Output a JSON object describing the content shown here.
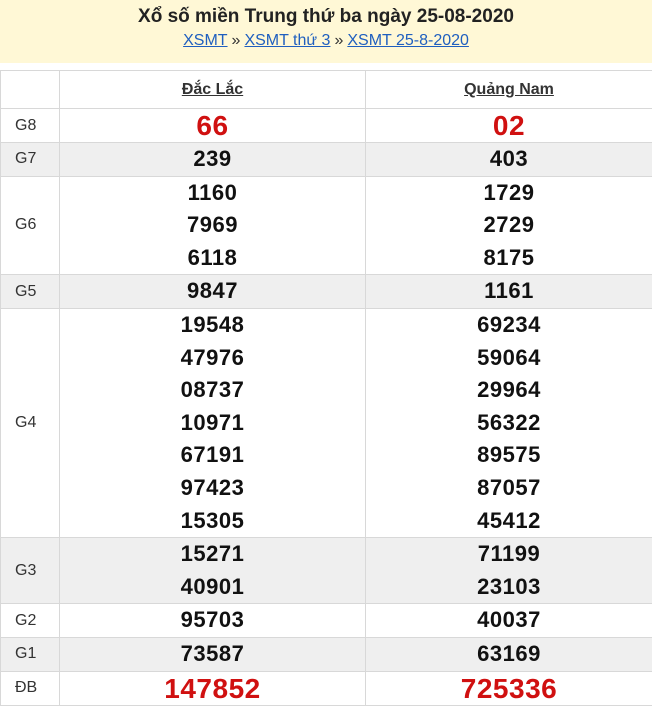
{
  "header": {
    "title": "Xổ số miền Trung thứ ba ngày 25-08-2020",
    "crumbs": [
      "XSMT",
      "XSMT thứ 3",
      "XSMT 25-8-2020"
    ],
    "separator": "»"
  },
  "table": {
    "provinces": [
      "Đắc Lắc",
      "Quảng Nam"
    ],
    "rows": [
      {
        "label": "G8",
        "a": [
          "66"
        ],
        "b": [
          "02"
        ]
      },
      {
        "label": "G7",
        "a": [
          "239"
        ],
        "b": [
          "403"
        ]
      },
      {
        "label": "G6",
        "a": [
          "1160",
          "7969",
          "6118"
        ],
        "b": [
          "1729",
          "2729",
          "8175"
        ]
      },
      {
        "label": "G5",
        "a": [
          "9847"
        ],
        "b": [
          "1161"
        ]
      },
      {
        "label": "G4",
        "a": [
          "19548",
          "47976",
          "08737",
          "10971",
          "67191",
          "97423",
          "15305"
        ],
        "b": [
          "69234",
          "59064",
          "29964",
          "56322",
          "89575",
          "87057",
          "45412"
        ]
      },
      {
        "label": "G3",
        "a": [
          "15271",
          "40901"
        ],
        "b": [
          "71199",
          "23103"
        ]
      },
      {
        "label": "G2",
        "a": [
          "95703"
        ],
        "b": [
          "40037"
        ]
      },
      {
        "label": "G1",
        "a": [
          "73587"
        ],
        "b": [
          "63169"
        ]
      },
      {
        "label": "ĐB",
        "a": [
          "147852"
        ],
        "b": [
          "725336"
        ]
      }
    ]
  },
  "colors": {
    "prize_red": "#d01010",
    "header_bg": "#fff8d6",
    "link": "#1f5fbf"
  }
}
